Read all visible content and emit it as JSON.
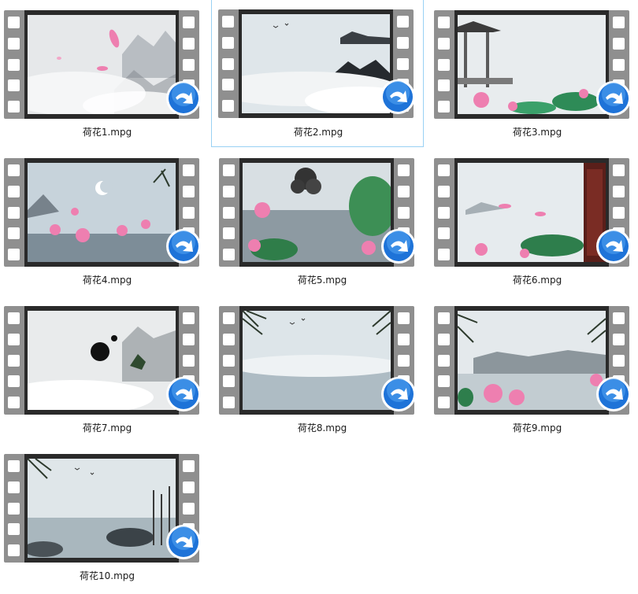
{
  "files": [
    {
      "name": "荷花1.mpg",
      "icon": "video-file-icon",
      "selected": false
    },
    {
      "name": "荷花2.mpg",
      "icon": "video-file-icon",
      "selected": true
    },
    {
      "name": "荷花3.mpg",
      "icon": "video-file-icon",
      "selected": false
    },
    {
      "name": "荷花4.mpg",
      "icon": "video-file-icon",
      "selected": false
    },
    {
      "name": "荷花5.mpg",
      "icon": "video-file-icon",
      "selected": false
    },
    {
      "name": "荷花6.mpg",
      "icon": "video-file-icon",
      "selected": false
    },
    {
      "name": "荷花7.mpg",
      "icon": "video-file-icon",
      "selected": false
    },
    {
      "name": "荷花8.mpg",
      "icon": "video-file-icon",
      "selected": false
    },
    {
      "name": "荷花9.mpg",
      "icon": "video-file-icon",
      "selected": false
    },
    {
      "name": "荷花10.mpg",
      "icon": "video-file-icon",
      "selected": false
    }
  ],
  "colors": {
    "selection_border": "#99d1f4",
    "film_strip": "#8f8f8f",
    "badge_blue": "#1e73d8",
    "lotus_pink": "#ee7fb0"
  }
}
